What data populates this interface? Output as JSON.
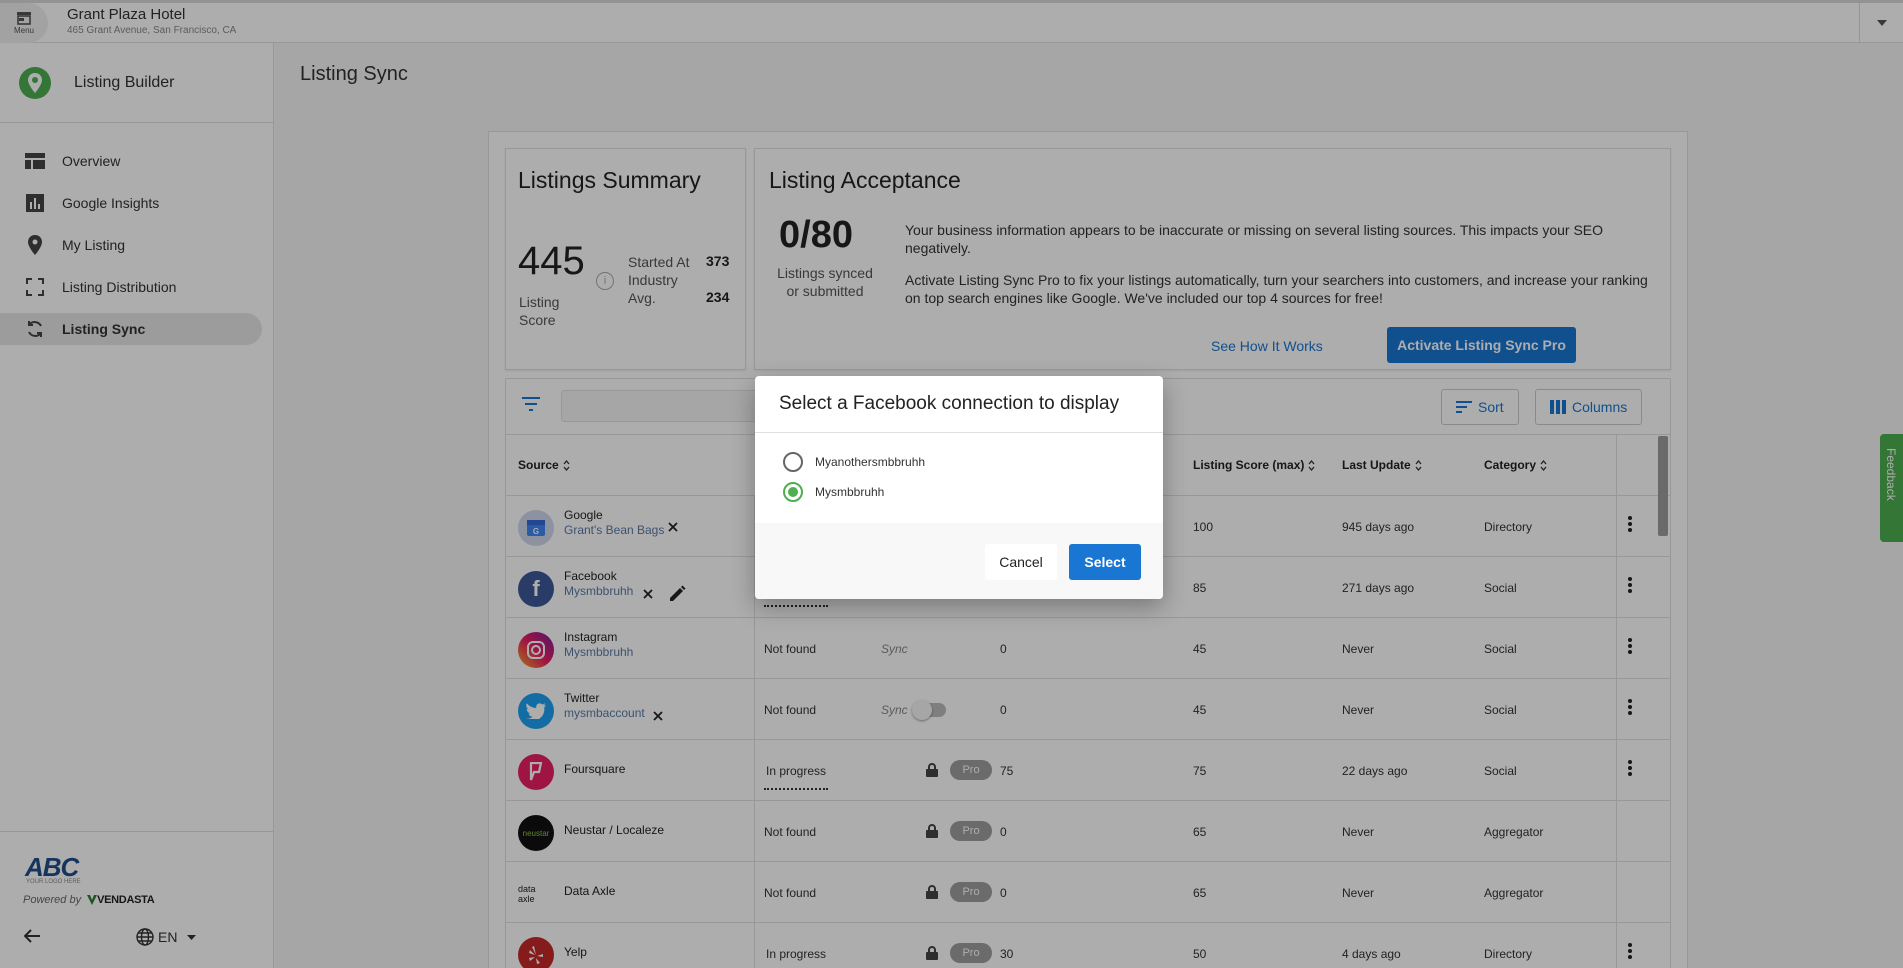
{
  "topbar": {
    "menu_label": "Menu",
    "business_name": "Grant Plaza Hotel",
    "business_address": "465 Grant Avenue, San Francisco, CA"
  },
  "sidebar": {
    "app_title": "Listing Builder",
    "items": [
      {
        "label": "Overview",
        "icon": "dashboard-icon"
      },
      {
        "label": "Google Insights",
        "icon": "bar-chart-icon"
      },
      {
        "label": "My Listing",
        "icon": "location-pin-icon"
      },
      {
        "label": "Listing Distribution",
        "icon": "expand-icon"
      },
      {
        "label": "Listing Sync",
        "icon": "sync-icon",
        "active": true
      }
    ],
    "footer": {
      "logo_text": "ABC",
      "logo_sub": "YOUR LOGO HERE",
      "powered_by": "Powered by",
      "vendor": "VENDASTA",
      "language": "EN"
    }
  },
  "page_title": "Listing Sync",
  "summary": {
    "title": "Listings Summary",
    "score": "445",
    "score_label": "Listing Score",
    "started_label": "Started At",
    "started_value": "373",
    "industry_label": "Industry Avg.",
    "industry_value": "234"
  },
  "acceptance": {
    "title": "Listing Acceptance",
    "count": "0/80",
    "count_label": "Listings synced or submitted",
    "text1": "Your business information appears to be inaccurate or missing on several listing sources. This impacts your SEO negatively.",
    "text2": "Activate Listing Sync Pro to fix your listings automatically, turn your searchers into customers, and increase your ranking on top search engines like Google. We've included our top 4 sources for free!",
    "see_how": "See How It Works",
    "activate": "Activate Listing Sync Pro"
  },
  "toolbar": {
    "sort_label": "Sort",
    "columns_label": "Columns"
  },
  "table": {
    "headers": {
      "source": "Source",
      "score_max": "Listing Score (max)",
      "last_update": "Last Update",
      "category": "Category"
    },
    "rows": [
      {
        "name": "Google",
        "sub": "Grant's Bean Bags",
        "status": "",
        "sync": "",
        "score": "",
        "max": "100",
        "updated": "945 days ago",
        "category": "Directory"
      },
      {
        "name": "Facebook",
        "sub": "Mysmbbruhh",
        "status": "",
        "sync": "",
        "score": "",
        "max": "85",
        "updated": "271 days ago",
        "category": "Social"
      },
      {
        "name": "Instagram",
        "sub": "Mysmbbruhh",
        "status": "Not found",
        "sync": "Sync",
        "score": "0",
        "max": "45",
        "updated": "Never",
        "category": "Social"
      },
      {
        "name": "Twitter",
        "sub": "mysmbaccount",
        "status": "Not found",
        "sync": "Sync",
        "score": "0",
        "max": "45",
        "updated": "Never",
        "category": "Social"
      },
      {
        "name": "Foursquare",
        "sub": "",
        "status": "In progress",
        "sync": "Pro",
        "score": "75",
        "max": "75",
        "updated": "22 days ago",
        "category": "Social"
      },
      {
        "name": "Neustar / Localeze",
        "sub": "",
        "status": "Not found",
        "sync": "Pro",
        "score": "0",
        "max": "65",
        "updated": "Never",
        "category": "Aggregator"
      },
      {
        "name": "Data Axle",
        "sub": "",
        "status": "Not found",
        "sync": "Pro",
        "score": "0",
        "max": "65",
        "updated": "Never",
        "category": "Aggregator"
      },
      {
        "name": "Yelp",
        "sub": "",
        "status": "In progress",
        "sync": "Pro",
        "score": "30",
        "max": "50",
        "updated": "4 days ago",
        "category": "Directory"
      }
    ],
    "logo_texts": {
      "neustar": "neustar",
      "data_axle": "data axle"
    }
  },
  "feedback_label": "Feedback",
  "dialog": {
    "title": "Select a Facebook connection to display",
    "options": [
      {
        "label": "Myanothersmbbruhh",
        "selected": false
      },
      {
        "label": "Mysmbbruhh",
        "selected": true
      }
    ],
    "cancel": "Cancel",
    "select": "Select"
  },
  "colors": {
    "primary": "#1976d2",
    "accent_green": "#4caf50"
  }
}
